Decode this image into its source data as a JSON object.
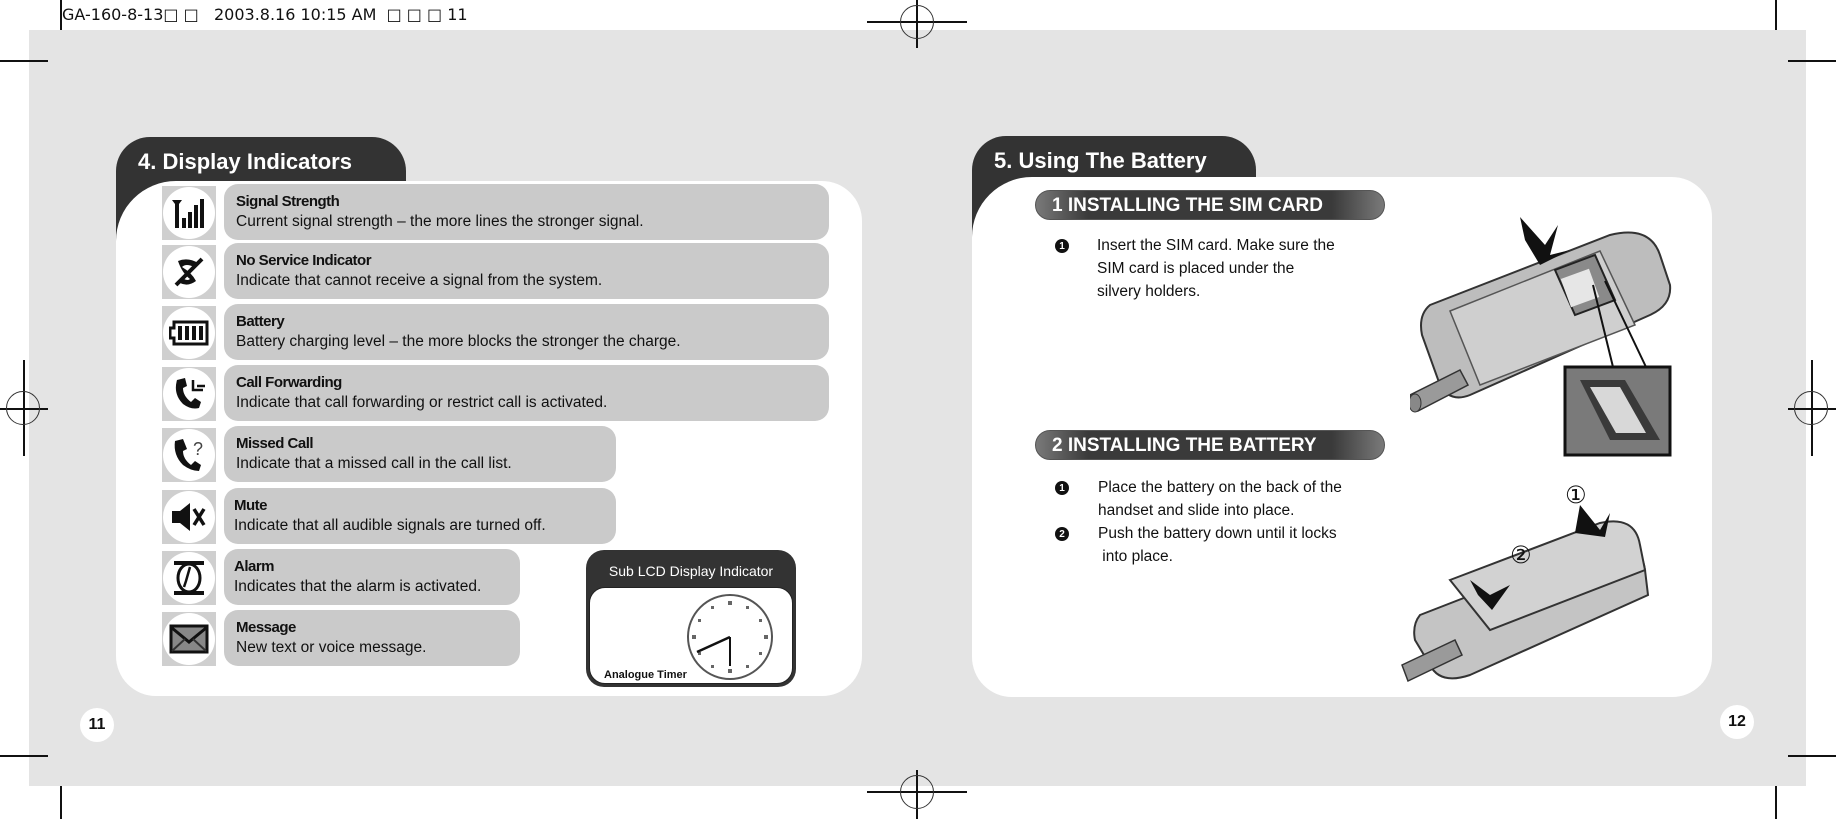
{
  "print_slug": "GA-160-8-13□ □   2003.8.16 10:15 AM  □ □ □ 11",
  "left_page": {
    "page_number": "11",
    "section_title": "4. Display Indicators",
    "indicators": [
      {
        "icon": "signal-strength-icon",
        "title": "Signal Strength",
        "description": "Current signal strength – the more lines the stronger signal."
      },
      {
        "icon": "no-service-icon",
        "title": "No Service Indicator",
        "description": "Indicate that cannot receive a signal from the system."
      },
      {
        "icon": "battery-icon",
        "title": "Battery",
        "description": "Battery charging level – the more blocks the stronger the charge."
      },
      {
        "icon": "call-forwarding-icon",
        "title": "Call Forwarding",
        "description": "Indicate that call forwarding or restrict call is activated."
      },
      {
        "icon": "missed-call-icon",
        "title": "Missed Call",
        "description": "Indicate that a missed call in the call list."
      },
      {
        "icon": "mute-icon",
        "title": "Mute",
        "description": "Indicate that all audible signals are turned off."
      },
      {
        "icon": "alarm-icon",
        "title": "Alarm",
        "description": "Indicates that the alarm is activated."
      },
      {
        "icon": "message-icon",
        "title": "Message",
        "description": "New text or voice message."
      }
    ],
    "sub_lcd": {
      "title": "Sub LCD Display Indicator",
      "label": "Analogue Timer",
      "icon": "analog-clock-icon"
    }
  },
  "right_page": {
    "page_number": "12",
    "section_title": "5. Using The Battery",
    "subsections": [
      {
        "heading": "1 INSTALLING THE SIM CARD",
        "steps": [
          {
            "bullet": "1",
            "text": "Insert the SIM card. Make sure the\nSIM card is placed under the\nsilvery holders."
          }
        ],
        "illustration": "phone-sim-card-illustration"
      },
      {
        "heading": "2 INSTALLING THE BATTERY",
        "steps": [
          {
            "bullet": "1",
            "text": "Place the battery on the back of the\nhandset and slide into place."
          },
          {
            "bullet": "2",
            "text": "Push the battery down until it locks\n into place."
          }
        ],
        "illustration": "phone-battery-illustration",
        "callouts": [
          "①",
          "②"
        ]
      }
    ]
  }
}
